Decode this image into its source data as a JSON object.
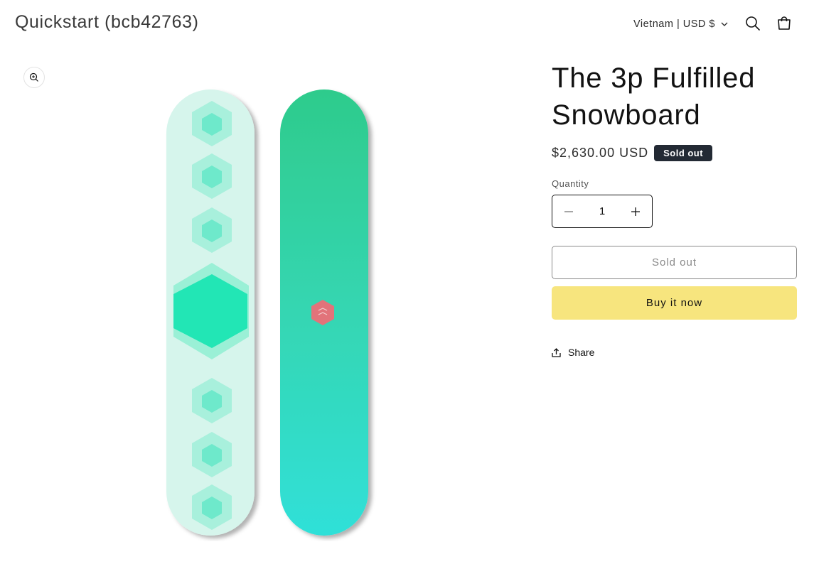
{
  "header": {
    "store_name": "Quickstart (bcb42763)",
    "localization_label": "Vietnam | USD $",
    "icons": {
      "search": "search-icon",
      "cart": "cart-icon",
      "dropdown": "chevron-down-icon"
    }
  },
  "gallery": {
    "zoom_icon": "zoom-in-icon",
    "image_alt": "The 3p Fulfilled Snowboard"
  },
  "product": {
    "title": "The 3p Fulfilled Snowboard",
    "price": "$2,630.00 USD",
    "badge": "Sold out",
    "quantity_label": "Quantity",
    "quantity_value": "1",
    "decrease_icon": "minus-icon",
    "increase_icon": "plus-icon",
    "sold_out_button": "Sold out",
    "buy_now_button": "Buy it now",
    "share_label": "Share",
    "share_icon": "share-icon"
  },
  "colors": {
    "badge_bg": "#232a34",
    "buy_now_bg": "#f7e57e",
    "board_light": "#d6f5ec",
    "board_teal": "#2fd4ad",
    "board_logo": "#e2737a"
  }
}
